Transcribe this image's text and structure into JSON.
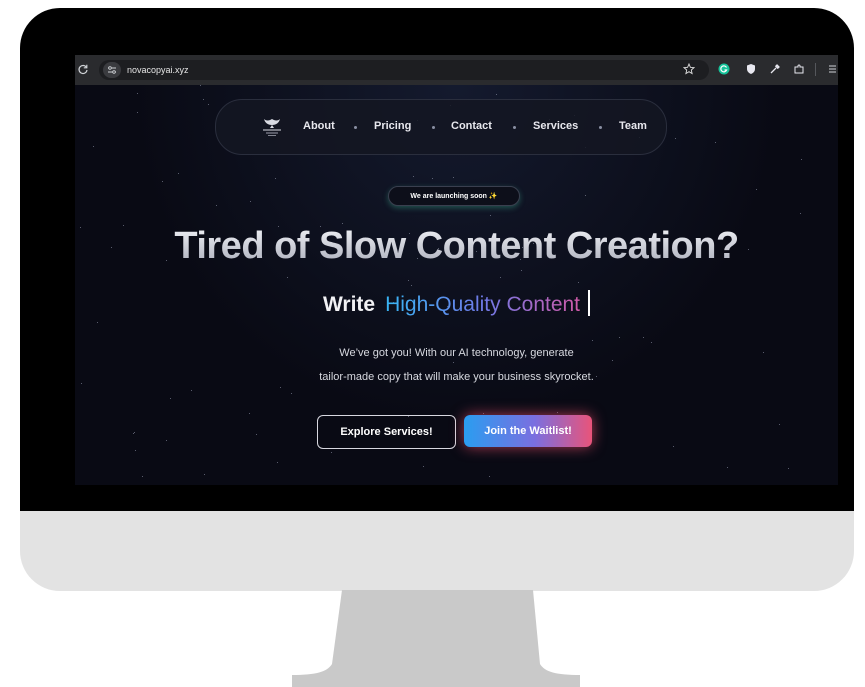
{
  "browser": {
    "url": "novacopyai.xyz"
  },
  "nav": {
    "items": [
      "About",
      "Pricing",
      "Contact",
      "Services",
      "Team"
    ]
  },
  "hero": {
    "badge": "We are launching soon ✨",
    "title": "Tired of Slow Content Creation?",
    "subtitle_static": "Write",
    "subtitle_animated": "High-Quality Content",
    "description_line1": "We’ve got you! With our AI technology, generate",
    "description_line2": "tailor-made copy that will make your business skyrocket.",
    "explore_button": "Explore Services!",
    "waitlist_button": "Join the Waitlist!"
  },
  "colors": {
    "page_background": "#0a0a14",
    "gradient_start": "#2a9df0",
    "gradient_mid": "#7a6fe0",
    "gradient_end": "#e9547a"
  }
}
